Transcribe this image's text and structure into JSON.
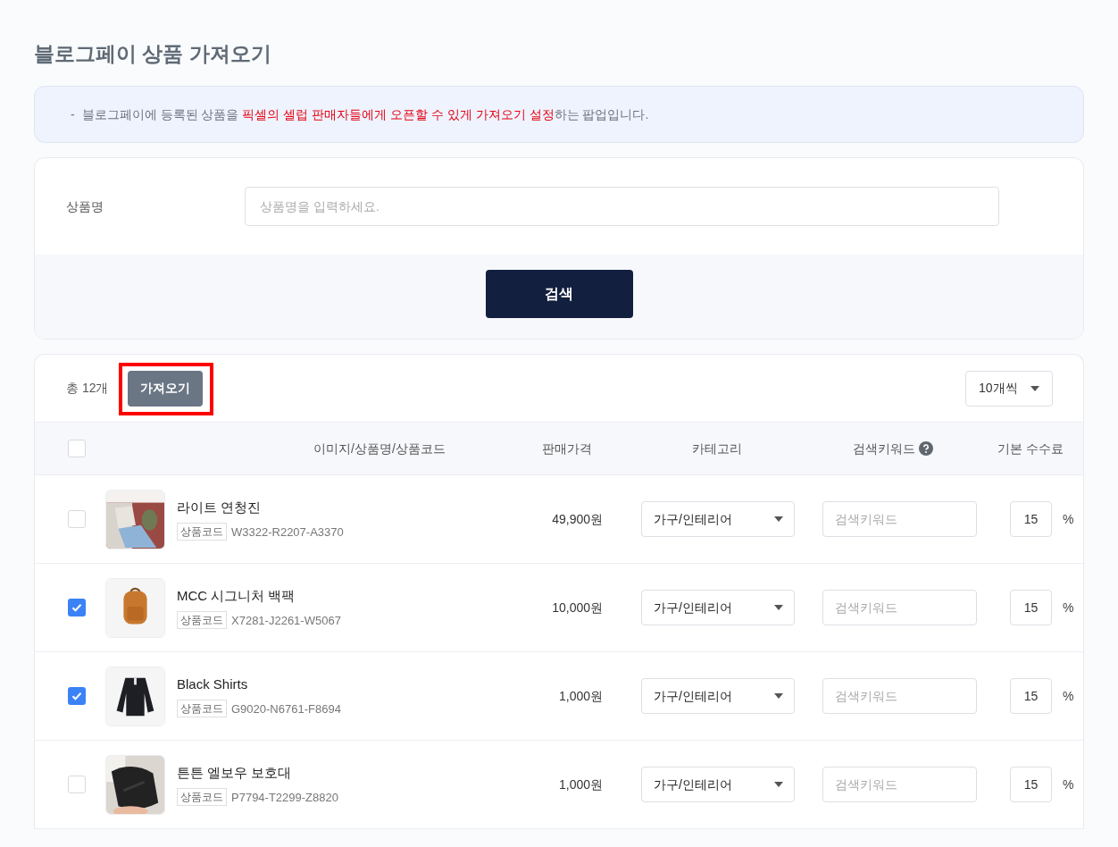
{
  "page_title": "블로그페이 상품 가져오기",
  "notice": {
    "bullet": "-",
    "segments": [
      {
        "text": "블로그페이에 등록된 상품을 ",
        "emphasis": false
      },
      {
        "text": "픽셀의 셀럽 판매자들에게 오픈할 수 있게 가져오기 설정",
        "emphasis": true
      },
      {
        "text": "하는 팝업입니다.",
        "emphasis": false
      }
    ]
  },
  "search": {
    "label": "상품명",
    "placeholder": "상품명을 입력하세요.",
    "button": "검색"
  },
  "list": {
    "total": "총 12개",
    "import_button": {
      "label": "가져오기",
      "highlighted": true
    },
    "page_size": "10개씩",
    "all_selected": false
  },
  "columns": [
    {
      "label": "이미지/상품명/상품코드",
      "help": false
    },
    {
      "label": "판매가격",
      "help": false
    },
    {
      "label": "카테고리",
      "help": false
    },
    {
      "label": "검색키워드",
      "help": true
    },
    {
      "label": "기본 수수료",
      "help": false
    }
  ],
  "rows": [
    {
      "selected": false,
      "name": "라이트 연청진",
      "code_label": "상품코드",
      "code": "W3322-R2207-A3370",
      "price": "49,900원",
      "category": "가구/인테리어",
      "keyword_placeholder": "검색키워드",
      "fee": "15",
      "fee_unit": "%"
    },
    {
      "selected": true,
      "name": "MCC 시그니처 백팩",
      "code_label": "상품코드",
      "code": "X7281-J2261-W5067",
      "price": "10,000원",
      "category": "가구/인테리어",
      "keyword_placeholder": "검색키워드",
      "fee": "15",
      "fee_unit": "%"
    },
    {
      "selected": true,
      "name": "Black Shirts",
      "code_label": "상품코드",
      "code": "G9020-N6761-F8694",
      "price": "1,000원",
      "category": "가구/인테리어",
      "keyword_placeholder": "검색키워드",
      "fee": "15",
      "fee_unit": "%"
    },
    {
      "selected": false,
      "name": "튼튼 엘보우 보호대",
      "code_label": "상품코드",
      "code": "P7794-T2299-Z8820",
      "price": "1,000원",
      "category": "가구/인테리어",
      "keyword_placeholder": "검색키워드",
      "fee": "15",
      "fee_unit": "%"
    }
  ]
}
